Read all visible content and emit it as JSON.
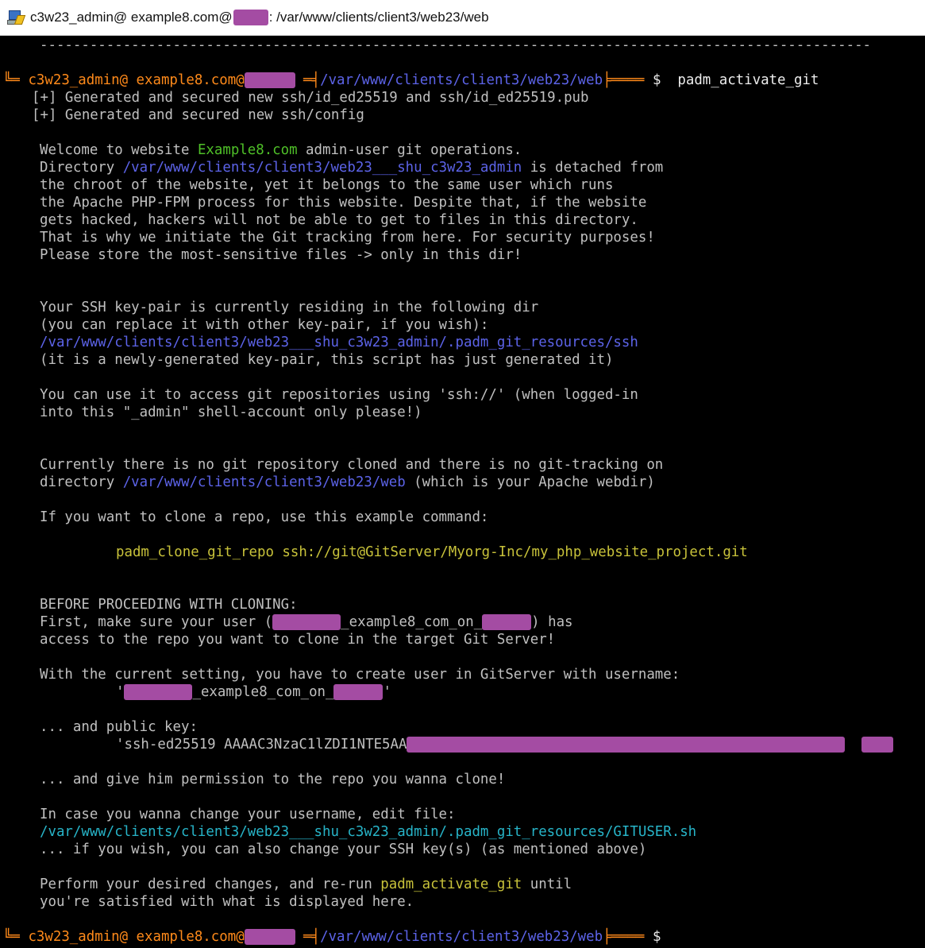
{
  "window": {
    "title_prefix": "c3w23_admin@ example8.com@",
    "title_suffix": ": /var/www/clients/client3/web23/web"
  },
  "terminal": {
    "separator": "----------------------------------------------------------------------------------------------------",
    "prompt": {
      "corner": "╚═",
      "user": "c3w23_admin@ example8.com@",
      "sep_left": "═╡",
      "path": "/var/www/clients/client3/web23/web",
      "sep_right": "╞════",
      "dollar": "$",
      "command": "padm_activate_git"
    },
    "gen1": "[+] Generated and secured new ssh/id_ed25519 and ssh/id_ed25519.pub",
    "gen2": "[+] Generated and secured new ssh/config",
    "welcome_pre": "Welcome to website ",
    "welcome_site": "Example8.com",
    "welcome_post": " admin-user git operations.",
    "dir_pre": "Directory ",
    "dir_path": "/var/www/clients/client3/web23___shu_c3w23_admin",
    "dir_post": " is detached from",
    "p1_l3": "the chroot of the website, yet it belongs to the same user which runs",
    "p1_l4": "the Apache PHP-FPM process for this website. Despite that, if the website",
    "p1_l5": "gets hacked, hackers will not be able to get to files in this directory.",
    "p1_l6": "That is why we initiate the Git tracking from here. For security purposes!",
    "p1_l7": "Please store the most-sensitive files -> only in this dir!",
    "ssh_l1": "Your SSH key-pair is currently residing in the following dir",
    "ssh_l2": "(you can replace it with other key-pair, if you wish):",
    "ssh_path": "/var/www/clients/client3/web23___shu_c3w23_admin/.padm_git_resources/ssh",
    "ssh_l4": "(it is a newly-generated key-pair, this script has just generated it)",
    "use_l1": "You can use it to access git repositories using 'ssh://' (when logged-in",
    "use_l2": "into this \"_admin\" shell-account only please!)",
    "cur_l1": "Currently there is no git repository cloned and there is no git-tracking on",
    "cur_pre": "directory ",
    "cur_path": "/var/www/clients/client3/web23/web",
    "cur_post": " (which is your Apache webdir)",
    "clone_intro": "If you want to clone a repo, use this example command:",
    "clone_cmd": "padm_clone_git_repo ssh://git@GitServer/Myorg-Inc/my_php_website_project.git",
    "before": "BEFORE PROCEEDING WITH CLONING:",
    "first_pre": "First, make sure your user (",
    "first_mid": "_example8_com_on_",
    "first_post": ") has",
    "access": "access to the repo you want to clone in the target Git Server!",
    "with": "With the current setting, you have to create user in GitServer with username:",
    "user_q1": "'",
    "user_mid": "_example8_com_on_",
    "user_q2": "'",
    "pubkey_intro": "... and public key:",
    "pubkey": "'ssh-ed25519 AAAAC3NzaC1lZDI1NTE5AA",
    "permission": "... and give him permission to the repo you wanna clone!",
    "change_l1": "In case you wanna change your username, edit file:",
    "change_path": "/var/www/clients/client3/web23___shu_c3w23_admin/.padm_git_resources/GITUSER.sh",
    "change_l3": "... if you wish, you can also change your SSH key(s) (as mentioned above)",
    "perform_pre": "Perform your desired changes, and re-run ",
    "perform_cmd": "padm_activate_git",
    "perform_post": " until",
    "satisfied": "you're satisfied with what is displayed here."
  },
  "colors": {
    "background": "#000000",
    "text": "#c0c0c0",
    "prompt_user": "#ff8a1a",
    "path_blue": "#5c63e8",
    "site_green": "#4fc028",
    "command_yellow": "#c8c23a",
    "file_cyan": "#27b4c8",
    "redaction": "#a44ca3"
  },
  "icons": {
    "app": "putty-terminal-icon"
  }
}
